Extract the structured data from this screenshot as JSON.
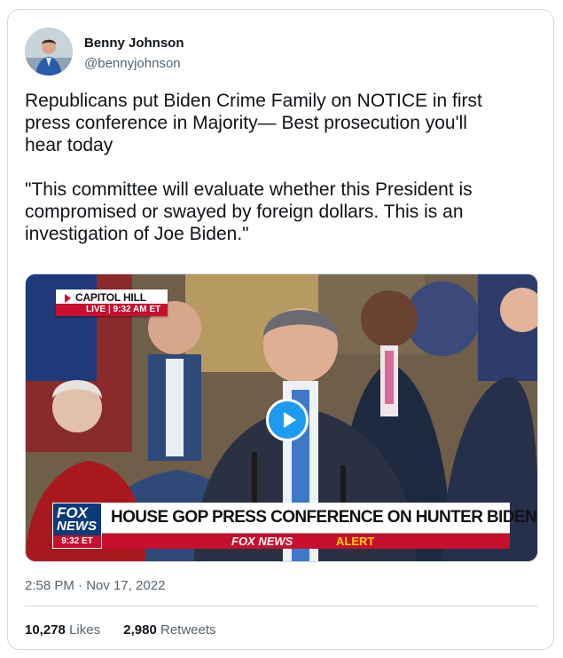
{
  "author": {
    "name": "Benny Johnson",
    "handle": "@bennyjohnson"
  },
  "tweet": {
    "text": "Republicans put Biden Crime Family on NOTICE in first\npress conference in Majority— Best prosecution you'll\nhear today\n\n\"This committee will evaluate whether this President is\ncompromised or swayed by foreign dollars. This is an\ninvestigation of Joe Biden.\"",
    "timestamp": "2:58 PM · Nov 17, 2022"
  },
  "media": {
    "location": "CAPITOL HILL",
    "live": "LIVE  |  9:32 AM ET",
    "network_line1": "FOX",
    "network_line2": "NEWS",
    "network_time": "9:32 ET",
    "headline": "HOUSE GOP PRESS CONFERENCE ON HUNTER BIDEN PROBE",
    "alert_brand": "FOX NEWS",
    "alert_word": "ALERT"
  },
  "stats": {
    "likes_count": "10,278",
    "likes_label": "Likes",
    "retweets_count": "2,980",
    "retweets_label": "Retweets"
  },
  "colors": {
    "link_blue": "#1d9bf0",
    "fox_red": "#c8102e",
    "fox_blue": "#0b3a78",
    "muted_text": "#536471"
  }
}
